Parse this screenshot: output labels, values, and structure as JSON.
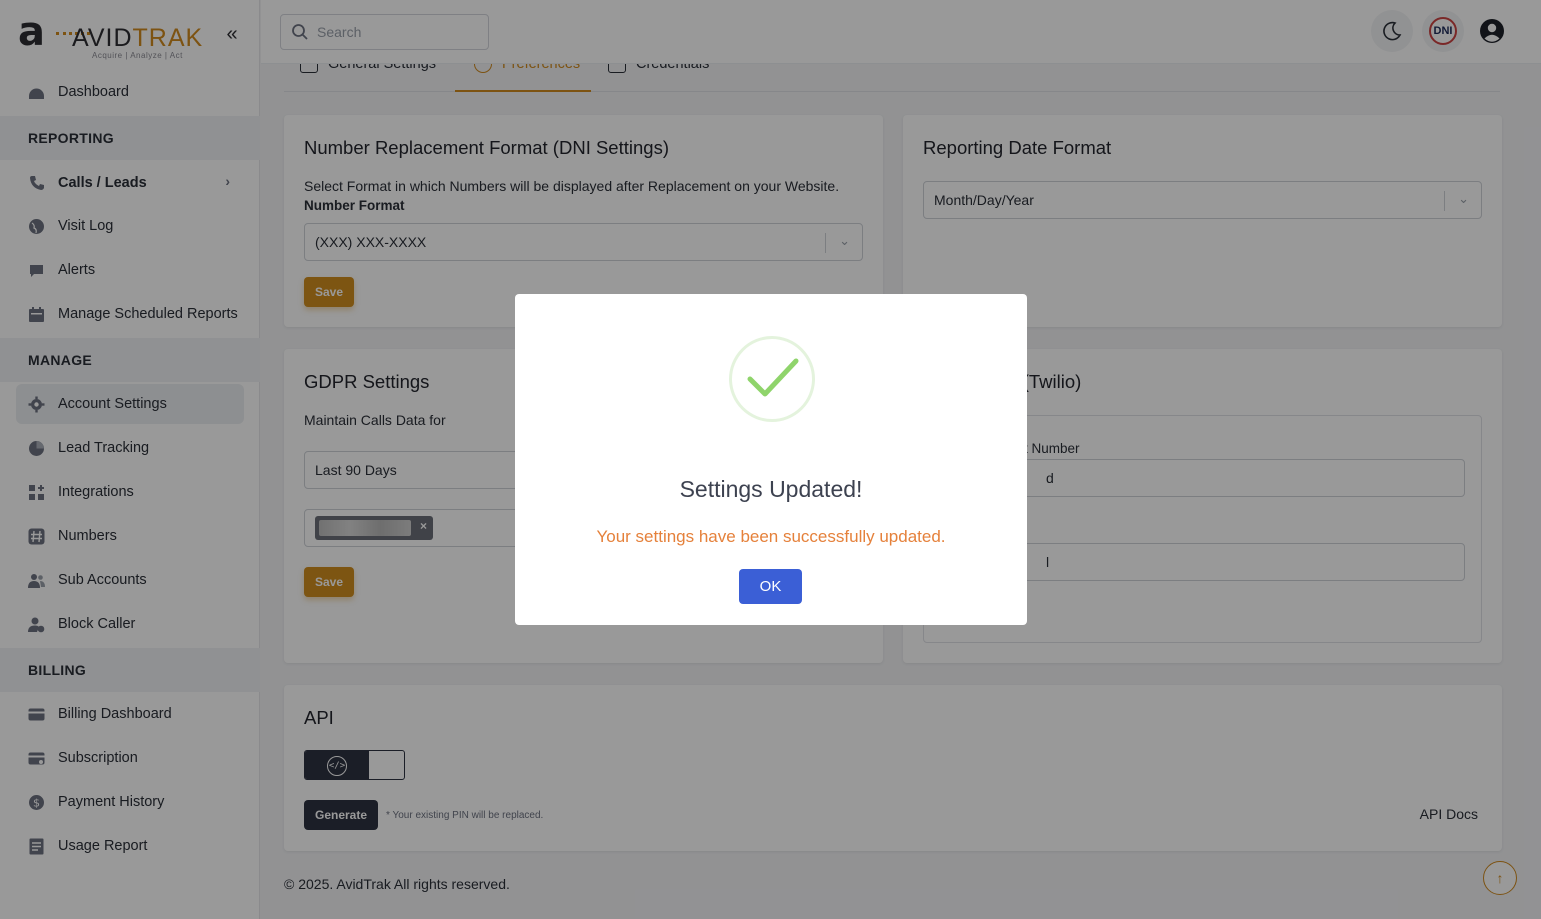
{
  "logo": {
    "mark": "a",
    "brand_prefix": "AVID",
    "brand_suffix": "TRAK",
    "tagline": "Acquire  |  Analyze  |  Act"
  },
  "topbar": {
    "search_placeholder": "Search",
    "dni_label": "DNI"
  },
  "sidebar": {
    "dashboard": "Dashboard",
    "section_reporting": "REPORTING",
    "calls_leads": "Calls / Leads",
    "visit_log": "Visit Log",
    "alerts": "Alerts",
    "manage_scheduled_reports": "Manage Scheduled Reports",
    "section_manage": "MANAGE",
    "account_settings": "Account Settings",
    "lead_tracking": "Lead Tracking",
    "integrations": "Integrations",
    "numbers": "Numbers",
    "sub_accounts": "Sub Accounts",
    "block_caller": "Block Caller",
    "section_billing": "BILLING",
    "billing_dashboard": "Billing Dashboard",
    "subscription": "Subscription",
    "payment_history": "Payment History",
    "usage_report": "Usage Report"
  },
  "tabs": {
    "general": "General Settings",
    "preferences": "Preferences",
    "credentials": "Credentials"
  },
  "dni_card": {
    "title": "Number Replacement Format (DNI Settings)",
    "description": "Select Format in which Numbers will be displayed after Replacement on your Website.",
    "field_label": "Number Format",
    "selected": "(XXX) XXX-XXXX",
    "save": "Save"
  },
  "date_card": {
    "title": "Reporting Date Format",
    "selected": "Month/Day/Year"
  },
  "gdpr_card": {
    "title": "GDPR Settings",
    "field_label": "Maintain Calls Data for",
    "selected": "Last 90 Days",
    "chip_remove": "×",
    "save": "Save"
  },
  "twilio_card": {
    "title_partial": "wn Number (Twilio)",
    "field_label_partial": "t Number",
    "input1_partial": "d",
    "input2_partial": "l"
  },
  "api_card": {
    "title": "API",
    "code_icon_text": "</>",
    "generate": "Generate",
    "pin_note": "* Your existing PIN will be replaced.",
    "docs": "API Docs"
  },
  "footer": {
    "copyright": "© 2025. AvidTrak All rights reserved."
  },
  "modal": {
    "title": "Settings Updated!",
    "message": "Your settings have been successfully updated.",
    "ok": "OK"
  },
  "colors": {
    "accent": "#d08a1f",
    "primary_button": "#3b5fd6",
    "success": "#8fd46b",
    "message": "#e5813b",
    "dark": "#2e3342"
  }
}
